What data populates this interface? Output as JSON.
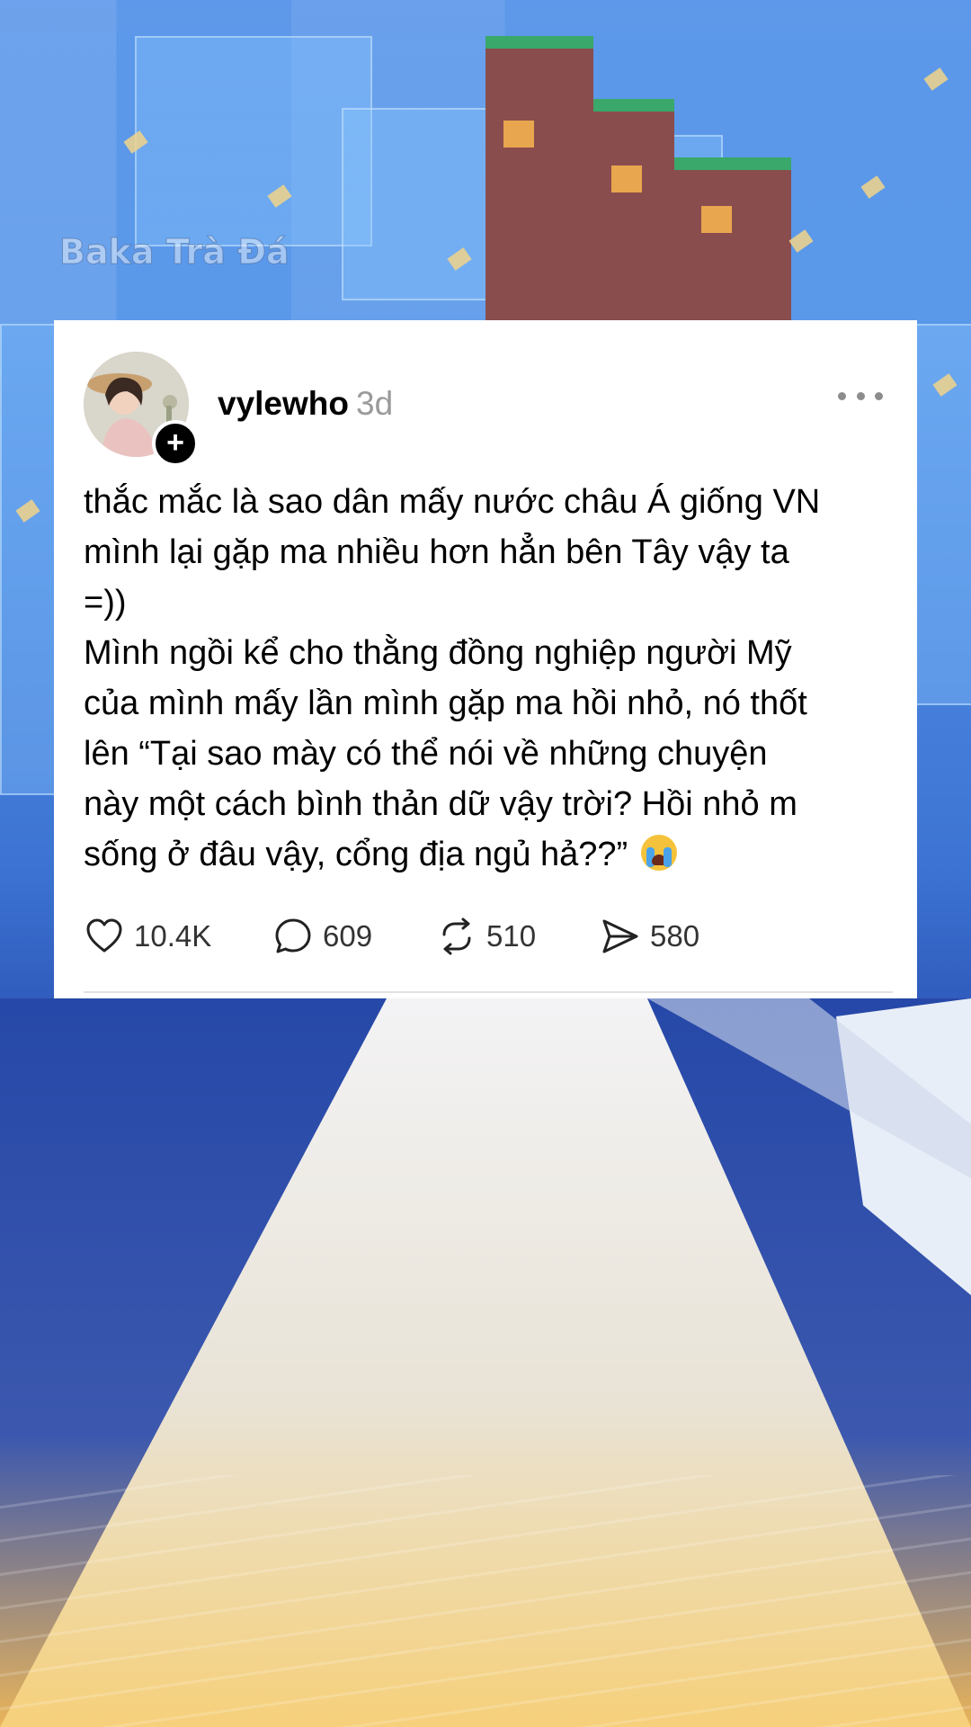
{
  "watermark": "Baka Trà Đá",
  "post": {
    "username": "vylewho",
    "time": "3d",
    "body_lines": [
      "thắc mắc là sao dân mấy nước châu Á giống VN",
      "mình lại gặp ma nhiều hơn hẳn bên Tây vậy ta",
      "=))",
      "Mình ngồi kể cho thằng đồng nghiệp người Mỹ",
      "của mình mấy lần mình gặp ma hồi nhỏ, nó thốt",
      "lên “Tại sao mày có thể nói về những chuyện",
      "này một cách bình thản dữ vậy trời? Hồi nhỏ m",
      "sống ở đâu vậy, cổng địa ngủ hả??”"
    ],
    "emoji": "loudly-crying-face-emoji",
    "actions": {
      "likes": "10.4K",
      "comments": "609",
      "reposts": "510",
      "shares": "580"
    }
  },
  "icons": {
    "like": "heart-icon",
    "comment": "comment-bubble-icon",
    "repost": "repost-icon",
    "share": "send-icon",
    "more": "more-options-icon",
    "follow": "plus-icon"
  }
}
